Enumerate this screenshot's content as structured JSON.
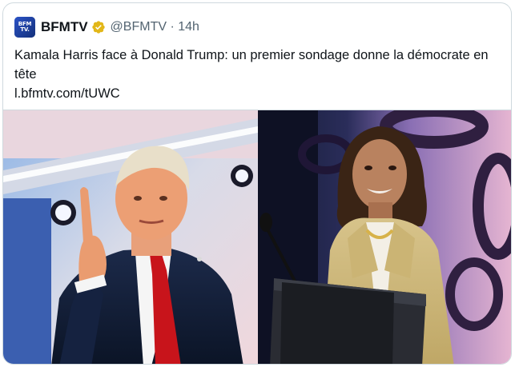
{
  "tweet": {
    "author_name": "BFMTV",
    "handle_time": "@BFMTV · 14h",
    "logo": {
      "line1": "BFM",
      "line2": "TV."
    },
    "verified_icon": "verified-gold-badge-icon",
    "text": "Kamala Harris face à Donald Trump: un premier sondage donne la démocrate en tête",
    "link": "l.bfmtv.com/tUWC"
  },
  "colors": {
    "logo_blue": "#1d3b8f",
    "verified_gold": "#e2b719",
    "handle_gray": "#536471",
    "border": "#cfd9de"
  }
}
